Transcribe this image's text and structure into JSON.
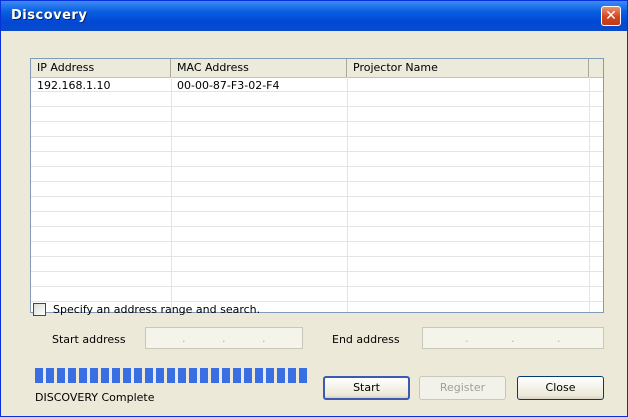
{
  "window": {
    "title": "Discovery"
  },
  "table": {
    "columns": [
      "IP Address",
      "MAC Address",
      "Projector Name"
    ],
    "rows": [
      {
        "ip": "192.168.1.10",
        "mac": "00-00-87-F3-02-F4",
        "name": ""
      }
    ]
  },
  "range": {
    "checkbox_label": "Specify an address range and search.",
    "checked": false,
    "start_label": "Start address",
    "end_label": "End address",
    "ip_separator": "."
  },
  "progress": {
    "fraction": 1.0
  },
  "status": {
    "text": "DISCOVERY Complete"
  },
  "buttons": {
    "start": "Start",
    "register": "Register",
    "close": "Close"
  },
  "colors": {
    "title_bar": "#0148d6",
    "progress": "#3a6fe3",
    "close_button": "#d2461f"
  }
}
